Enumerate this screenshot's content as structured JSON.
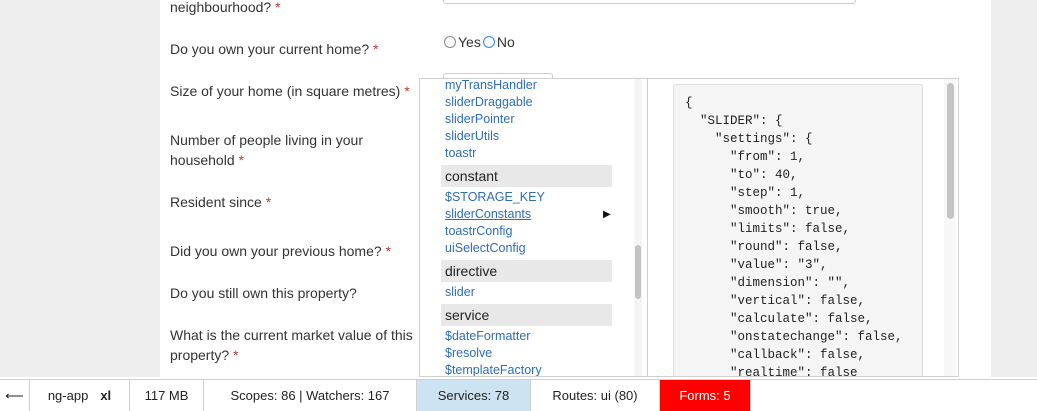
{
  "form": {
    "q_neighbourhood": "neighbourhood?",
    "q_own_home": "Do you own your current home?",
    "q_size": "Size of your home (in square metres)",
    "q_people_1": "Number of people living in your",
    "q_people_2": "household",
    "q_resident": "Resident since",
    "q_prev_home": "Did you own your previous home?",
    "q_still_own": "Do you still own this property?",
    "q_market_1": "What is the current market value of this",
    "q_market_2": "property?",
    "required_mark": "*",
    "radio_yes": "Yes",
    "radio_no": "No",
    "radio_selected": "No"
  },
  "inspector": {
    "items_top": [
      "myTransHandler",
      "sliderDraggable",
      "sliderPointer",
      "sliderUtils",
      "toastr"
    ],
    "group_constant": "constant",
    "items_constant": [
      "$STORAGE_KEY",
      "sliderConstants",
      "toastrConfig",
      "uiSelectConfig"
    ],
    "selected_item": "sliderConstants",
    "group_directive": "directive",
    "items_directive": [
      "slider"
    ],
    "group_service": "service",
    "items_service": [
      "$dateFormatter",
      "$resolve",
      "$templateFactory"
    ],
    "arrow": "▶",
    "code": "{\n  \"SLIDER\": {\n    \"settings\": {\n      \"from\": 1,\n      \"to\": 40,\n      \"step\": 1,\n      \"smooth\": true,\n      \"limits\": false,\n      \"round\": false,\n      \"value\": \"3\",\n      \"dimension\": \"\",\n      \"vertical\": false,\n      \"calculate\": false,\n      \"onstatechange\": false,\n      \"callback\": false,\n      \"realtime\": false"
  },
  "bottombar": {
    "back_arrow": "⟵",
    "app": "ng-app",
    "app_size": "xl",
    "memory": "117 MB",
    "scopes": "Scopes: 86 | Watchers: 167",
    "services": "Services: 78",
    "routes": "Routes: ui (80)",
    "forms": "Forms: 5"
  },
  "colors": {
    "link": "#2d6db5",
    "required": "#c0392b",
    "active_tab": "#cde3f1",
    "alert_tab": "#ff0000"
  }
}
